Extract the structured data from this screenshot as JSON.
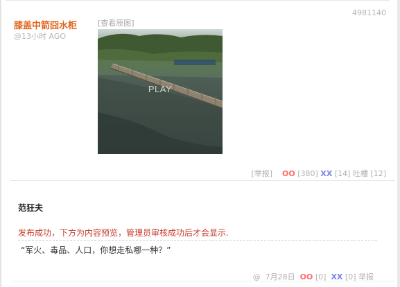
{
  "post": {
    "id": "4981140",
    "author": "膝盖中箭囧水柜",
    "time": "@13小时 AGO",
    "view_original": "[查看原图]",
    "media_label": "PLAY",
    "actions": {
      "report": "[举报]",
      "oo_label": "OO",
      "oo_count": "[380]",
      "xx_label": "XX",
      "xx_count": "[14]",
      "tucao_label": "吐槽",
      "tucao_count": "[12]"
    }
  },
  "comment": {
    "author": "范狂夫",
    "notice": "发布成功，下方为内容预览，管理员审核成功后才会显示.",
    "text": "“军火、毒品、人口，你想走私哪一种？”",
    "footer": {
      "at": "@",
      "date": "7月28日",
      "oo_label": "OO",
      "oo_count": "[0]",
      "xx_label": "XX",
      "xx_count": "[0]",
      "report": "举报"
    }
  },
  "colors": {
    "author": "#e0631b",
    "notice": "#c43d2d",
    "oo": "#ff6a6a",
    "xx": "#7b86e8",
    "muted": "#b0b0b0"
  },
  "icons": [
    "play-video-thumbnail"
  ]
}
